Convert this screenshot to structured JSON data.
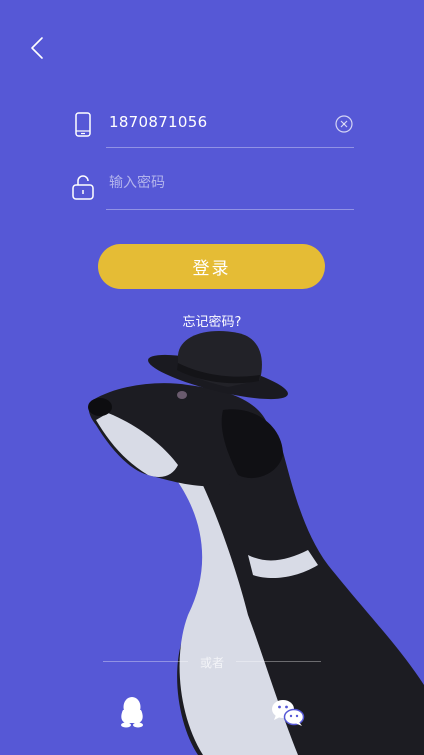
{
  "header": {
    "back_icon": "chevron-left-icon"
  },
  "form": {
    "phone": {
      "icon": "phone-icon",
      "value": "1870871056",
      "clear_icon": "clear-circle-icon"
    },
    "password": {
      "icon": "lock-icon",
      "placeholder": "输入密码"
    },
    "login_label": "登录",
    "forgot_label": "忘记密码?"
  },
  "social": {
    "divider_text": "或者",
    "qq_icon": "qq-penguin-icon",
    "wechat_icon": "wechat-icon"
  },
  "colors": {
    "background": "#5658d6",
    "accent_button": "#e5bc35",
    "text": "#ffffff"
  }
}
